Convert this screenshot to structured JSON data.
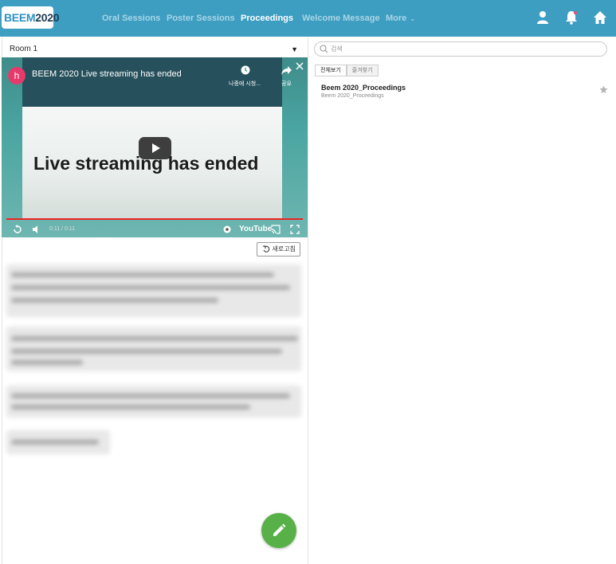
{
  "header": {
    "logo_part1": "BEEM",
    "logo_part2": "2020",
    "nav": [
      {
        "label": "Oral Sessions"
      },
      {
        "label": "Poster Sessions"
      },
      {
        "label": "Proceedings",
        "active": true
      },
      {
        "label": "Welcome Message"
      },
      {
        "label": "More"
      }
    ],
    "icons": [
      "user-icon",
      "bell-icon",
      "home-icon"
    ],
    "colors": {
      "bar": "#3d9ec1",
      "active": "#ffffff",
      "inactive": "#a9d5e6"
    }
  },
  "left": {
    "room": "Room 1",
    "video": {
      "avatar_letter": "h",
      "title": "BEEM 2020 Live streaming has ended",
      "slide_text": "Live streaming has ended",
      "watch_later": "나중에 시청...",
      "share": "공유",
      "time": "0:11 / 0:11",
      "brand": "YouTube"
    },
    "refresh_label": "새로고침"
  },
  "right": {
    "search_placeholder": "검색",
    "tabs": [
      {
        "label": "전체보기",
        "active": true
      },
      {
        "label": "즐겨찾기"
      }
    ],
    "items": [
      {
        "title": "Beem 2020_Proceedings",
        "subtitle": "Beem 2020_Proceedings"
      }
    ]
  }
}
